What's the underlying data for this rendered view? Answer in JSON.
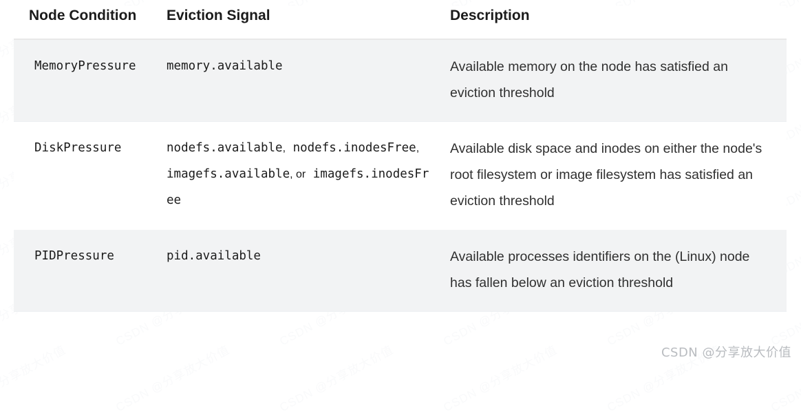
{
  "table": {
    "headers": [
      "Node Condition",
      "Eviction Signal",
      "Description"
    ],
    "rows": [
      {
        "condition": "MemoryPressure",
        "signals": [
          {
            "code": "memory.available",
            "sep": ""
          }
        ],
        "description": "Available memory on the node has satisfied an eviction threshold"
      },
      {
        "condition": "DiskPressure",
        "signals": [
          {
            "code": "nodefs.available",
            "sep": ","
          },
          {
            "code": "nodefs.inodesFree",
            "sep": ","
          },
          {
            "code": "imagefs.available",
            "sep": ", or"
          },
          {
            "code": "imagefs.inodesFree",
            "sep": ""
          }
        ],
        "description": "Available disk space and inodes on either the node's root filesystem or image filesystem has satisfied an eviction threshold"
      },
      {
        "condition": "PIDPressure",
        "signals": [
          {
            "code": "pid.available",
            "sep": ""
          }
        ],
        "description": "Available processes identifiers on the (Linux) node has fallen below an eviction threshold"
      }
    ]
  },
  "watermark": {
    "text": "CSDN @分享放大价值",
    "background_text": "CSDN @分享放大价值"
  },
  "colors": {
    "row_shaded": "#f2f3f4",
    "row_plain": "#ffffff",
    "text": "#1b1b1b",
    "description_text": "#303030",
    "border": "#eceff1",
    "watermark": "#b9bcc0"
  }
}
